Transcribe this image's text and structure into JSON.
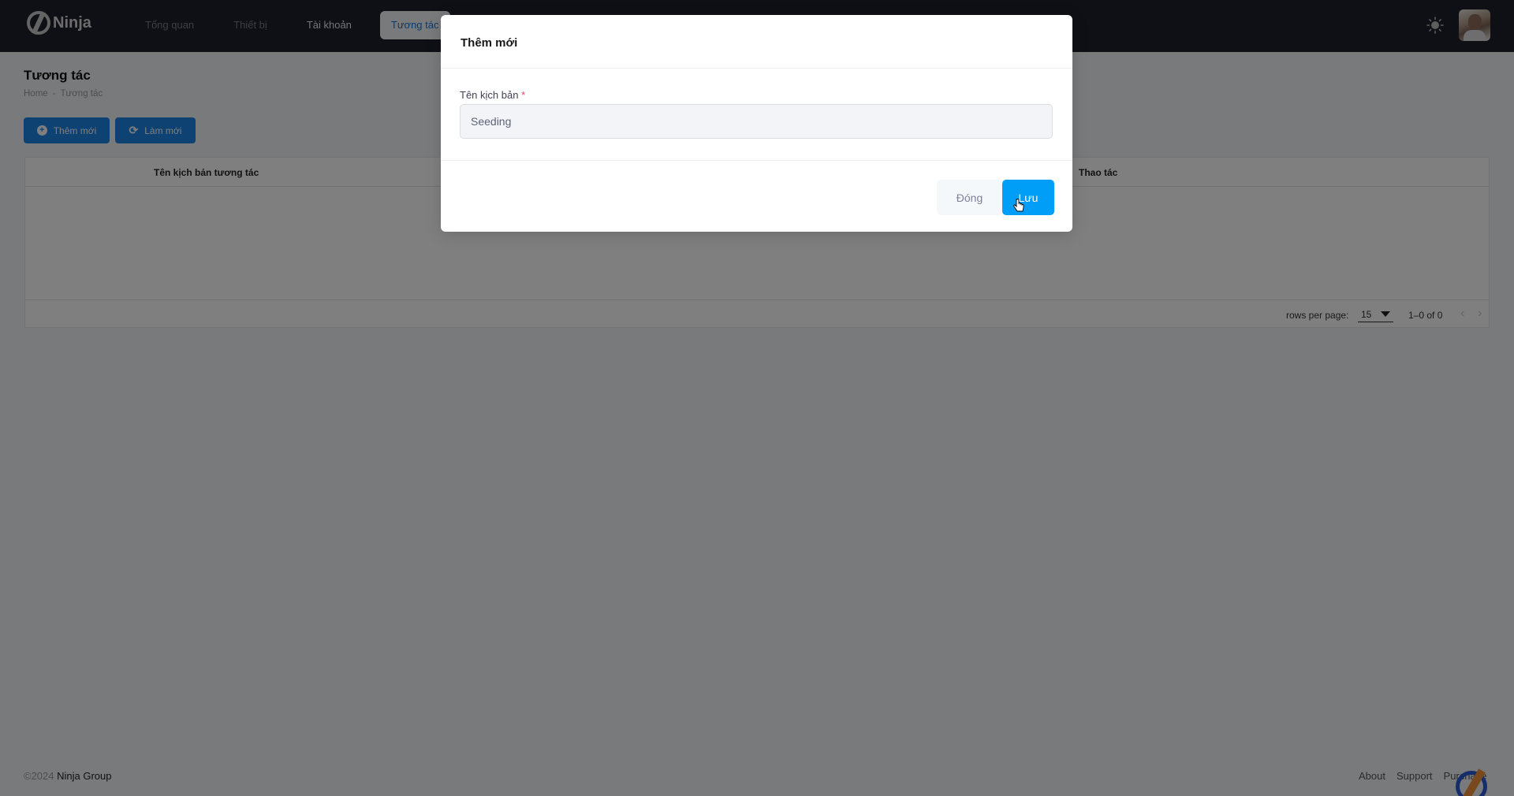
{
  "app": {
    "logo_text": "Ninja",
    "nav": [
      {
        "label": "Tổng quan",
        "state": "dim"
      },
      {
        "label": "Thiết bị",
        "state": "dim"
      },
      {
        "label": "Tài khoản",
        "state": "normal"
      },
      {
        "label": "Tương tác",
        "state": "active"
      }
    ],
    "theme_icon": "sun-icon",
    "avatar_icon": "user-avatar"
  },
  "page": {
    "title": "Tương tác",
    "breadcrumb": [
      "Home",
      "-",
      "Tương tác"
    ],
    "actions": {
      "add_label": "Thêm mới",
      "add_icon": "plus-circle-icon",
      "refresh_label": "Làm mới",
      "refresh_icon": "refresh-icon"
    }
  },
  "table": {
    "columns": [
      "Tên kịch bản tương tác",
      "Thao tác"
    ],
    "rows": [],
    "footer": {
      "rows_per_page_label": "rows per page:",
      "rows_per_page_value": "15",
      "range_text": "1–0 of 0",
      "prev_icon": "‹",
      "next_icon": "›"
    }
  },
  "footer": {
    "copyright": "©2024",
    "org": "Ninja Group",
    "links": [
      "About",
      "Support",
      "Purchase"
    ]
  },
  "modal": {
    "title": "Thêm mới",
    "field_label": "Tên kịch bản",
    "required_mark": "*",
    "field_value": "Seeding",
    "close_label": "Đóng",
    "save_label": "Lưu"
  }
}
